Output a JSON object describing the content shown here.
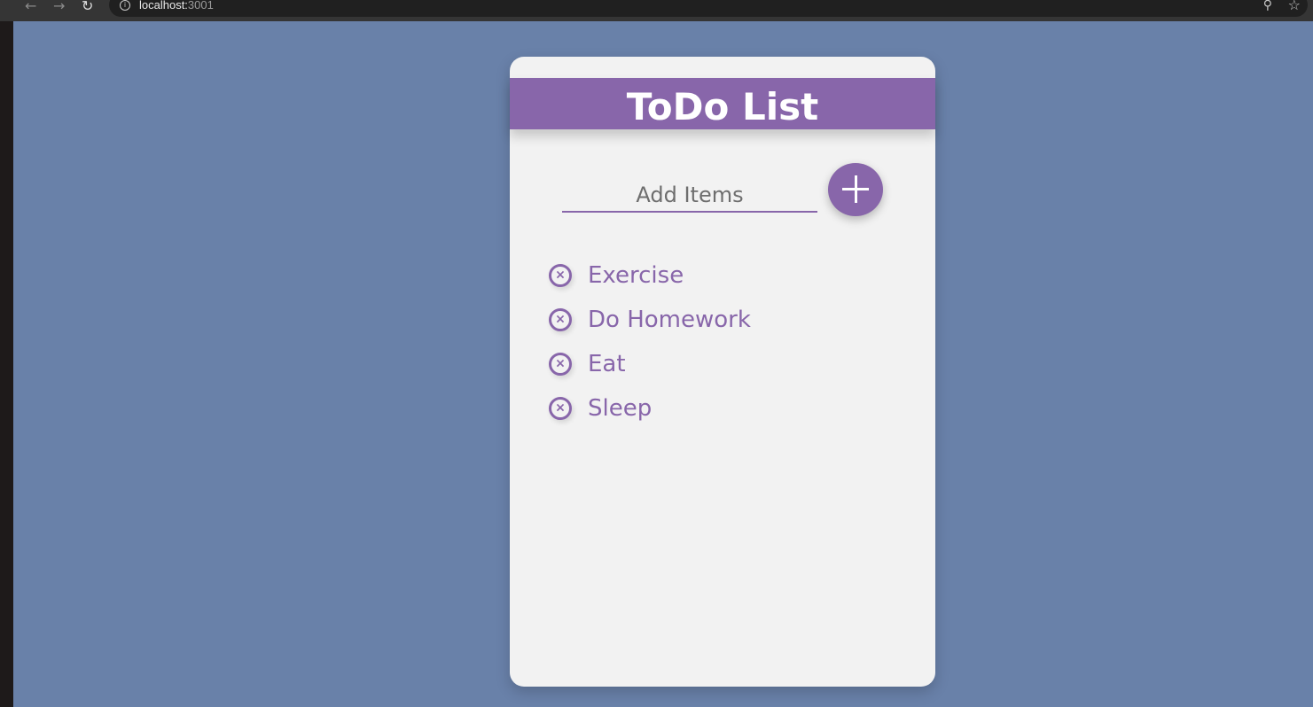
{
  "browser": {
    "url_host": "localhost:",
    "url_port": "3001",
    "back_icon": "arrow-left",
    "forward_icon": "arrow-right",
    "reload_icon": "reload",
    "info_icon": "info",
    "zoom_icon": "zoom",
    "star_icon": "star"
  },
  "colors": {
    "page_background": "#6981a9",
    "card_background": "#f2f2f2",
    "accent": "#8866aa"
  },
  "app": {
    "title": "ToDo List",
    "input": {
      "placeholder": "Add Items",
      "value": ""
    },
    "add_button_icon": "plus-icon",
    "items": [
      {
        "text": "Exercise"
      },
      {
        "text": "Do Homework"
      },
      {
        "text": "Eat"
      },
      {
        "text": "Sleep"
      }
    ],
    "delete_icon": "close-circle-icon"
  }
}
